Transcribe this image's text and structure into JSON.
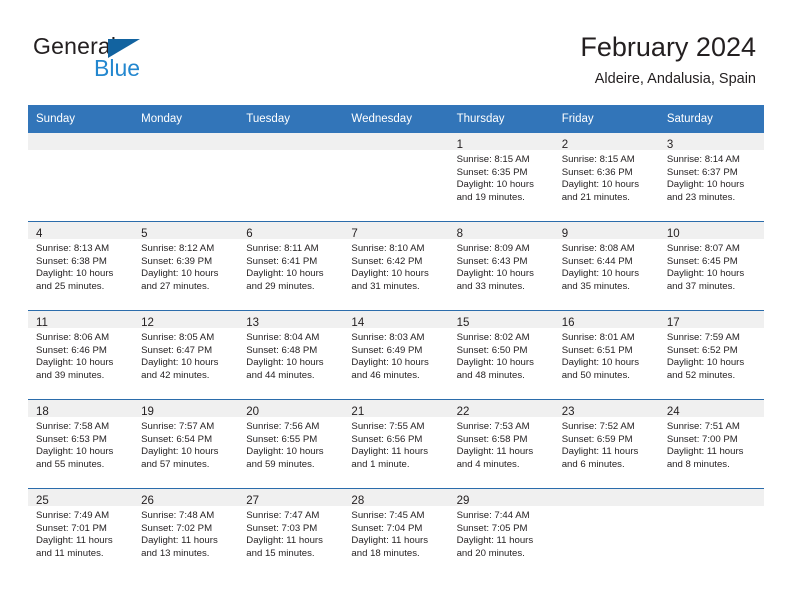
{
  "brand": {
    "name_part1": "General",
    "name_part2": "Blue",
    "triangle_color": "#1263a0",
    "blue_text_color": "#2387cf"
  },
  "header": {
    "title": "February 2024",
    "subtitle": "Aldeire, Andalusia, Spain"
  },
  "theme": {
    "header_row_bg": "#3275b9",
    "row_separator": "#2b6cab",
    "daynum_band_bg": "#f0f0f0",
    "text": "#231f20"
  },
  "weekday_headers": [
    "Sunday",
    "Monday",
    "Tuesday",
    "Wednesday",
    "Thursday",
    "Friday",
    "Saturday"
  ],
  "labels": {
    "sunrise_prefix": "Sunrise:",
    "sunset_prefix": "Sunset:",
    "daylight_prefix": "Daylight:"
  },
  "weeks": [
    [
      {
        "day": "",
        "sunrise": "",
        "sunset": "",
        "daylight_line1": "",
        "daylight_line2": "",
        "empty": true
      },
      {
        "day": "",
        "sunrise": "",
        "sunset": "",
        "daylight_line1": "",
        "daylight_line2": "",
        "empty": true
      },
      {
        "day": "",
        "sunrise": "",
        "sunset": "",
        "daylight_line1": "",
        "daylight_line2": "",
        "empty": true
      },
      {
        "day": "",
        "sunrise": "",
        "sunset": "",
        "daylight_line1": "",
        "daylight_line2": "",
        "empty": true
      },
      {
        "day": "1",
        "sunrise": "Sunrise: 8:15 AM",
        "sunset": "Sunset: 6:35 PM",
        "daylight_line1": "Daylight: 10 hours",
        "daylight_line2": "and 19 minutes."
      },
      {
        "day": "2",
        "sunrise": "Sunrise: 8:15 AM",
        "sunset": "Sunset: 6:36 PM",
        "daylight_line1": "Daylight: 10 hours",
        "daylight_line2": "and 21 minutes."
      },
      {
        "day": "3",
        "sunrise": "Sunrise: 8:14 AM",
        "sunset": "Sunset: 6:37 PM",
        "daylight_line1": "Daylight: 10 hours",
        "daylight_line2": "and 23 minutes."
      }
    ],
    [
      {
        "day": "4",
        "sunrise": "Sunrise: 8:13 AM",
        "sunset": "Sunset: 6:38 PM",
        "daylight_line1": "Daylight: 10 hours",
        "daylight_line2": "and 25 minutes."
      },
      {
        "day": "5",
        "sunrise": "Sunrise: 8:12 AM",
        "sunset": "Sunset: 6:39 PM",
        "daylight_line1": "Daylight: 10 hours",
        "daylight_line2": "and 27 minutes."
      },
      {
        "day": "6",
        "sunrise": "Sunrise: 8:11 AM",
        "sunset": "Sunset: 6:41 PM",
        "daylight_line1": "Daylight: 10 hours",
        "daylight_line2": "and 29 minutes."
      },
      {
        "day": "7",
        "sunrise": "Sunrise: 8:10 AM",
        "sunset": "Sunset: 6:42 PM",
        "daylight_line1": "Daylight: 10 hours",
        "daylight_line2": "and 31 minutes."
      },
      {
        "day": "8",
        "sunrise": "Sunrise: 8:09 AM",
        "sunset": "Sunset: 6:43 PM",
        "daylight_line1": "Daylight: 10 hours",
        "daylight_line2": "and 33 minutes."
      },
      {
        "day": "9",
        "sunrise": "Sunrise: 8:08 AM",
        "sunset": "Sunset: 6:44 PM",
        "daylight_line1": "Daylight: 10 hours",
        "daylight_line2": "and 35 minutes."
      },
      {
        "day": "10",
        "sunrise": "Sunrise: 8:07 AM",
        "sunset": "Sunset: 6:45 PM",
        "daylight_line1": "Daylight: 10 hours",
        "daylight_line2": "and 37 minutes."
      }
    ],
    [
      {
        "day": "11",
        "sunrise": "Sunrise: 8:06 AM",
        "sunset": "Sunset: 6:46 PM",
        "daylight_line1": "Daylight: 10 hours",
        "daylight_line2": "and 39 minutes."
      },
      {
        "day": "12",
        "sunrise": "Sunrise: 8:05 AM",
        "sunset": "Sunset: 6:47 PM",
        "daylight_line1": "Daylight: 10 hours",
        "daylight_line2": "and 42 minutes."
      },
      {
        "day": "13",
        "sunrise": "Sunrise: 8:04 AM",
        "sunset": "Sunset: 6:48 PM",
        "daylight_line1": "Daylight: 10 hours",
        "daylight_line2": "and 44 minutes."
      },
      {
        "day": "14",
        "sunrise": "Sunrise: 8:03 AM",
        "sunset": "Sunset: 6:49 PM",
        "daylight_line1": "Daylight: 10 hours",
        "daylight_line2": "and 46 minutes."
      },
      {
        "day": "15",
        "sunrise": "Sunrise: 8:02 AM",
        "sunset": "Sunset: 6:50 PM",
        "daylight_line1": "Daylight: 10 hours",
        "daylight_line2": "and 48 minutes."
      },
      {
        "day": "16",
        "sunrise": "Sunrise: 8:01 AM",
        "sunset": "Sunset: 6:51 PM",
        "daylight_line1": "Daylight: 10 hours",
        "daylight_line2": "and 50 minutes."
      },
      {
        "day": "17",
        "sunrise": "Sunrise: 7:59 AM",
        "sunset": "Sunset: 6:52 PM",
        "daylight_line1": "Daylight: 10 hours",
        "daylight_line2": "and 52 minutes."
      }
    ],
    [
      {
        "day": "18",
        "sunrise": "Sunrise: 7:58 AM",
        "sunset": "Sunset: 6:53 PM",
        "daylight_line1": "Daylight: 10 hours",
        "daylight_line2": "and 55 minutes."
      },
      {
        "day": "19",
        "sunrise": "Sunrise: 7:57 AM",
        "sunset": "Sunset: 6:54 PM",
        "daylight_line1": "Daylight: 10 hours",
        "daylight_line2": "and 57 minutes."
      },
      {
        "day": "20",
        "sunrise": "Sunrise: 7:56 AM",
        "sunset": "Sunset: 6:55 PM",
        "daylight_line1": "Daylight: 10 hours",
        "daylight_line2": "and 59 minutes."
      },
      {
        "day": "21",
        "sunrise": "Sunrise: 7:55 AM",
        "sunset": "Sunset: 6:56 PM",
        "daylight_line1": "Daylight: 11 hours",
        "daylight_line2": "and 1 minute."
      },
      {
        "day": "22",
        "sunrise": "Sunrise: 7:53 AM",
        "sunset": "Sunset: 6:58 PM",
        "daylight_line1": "Daylight: 11 hours",
        "daylight_line2": "and 4 minutes."
      },
      {
        "day": "23",
        "sunrise": "Sunrise: 7:52 AM",
        "sunset": "Sunset: 6:59 PM",
        "daylight_line1": "Daylight: 11 hours",
        "daylight_line2": "and 6 minutes."
      },
      {
        "day": "24",
        "sunrise": "Sunrise: 7:51 AM",
        "sunset": "Sunset: 7:00 PM",
        "daylight_line1": "Daylight: 11 hours",
        "daylight_line2": "and 8 minutes."
      }
    ],
    [
      {
        "day": "25",
        "sunrise": "Sunrise: 7:49 AM",
        "sunset": "Sunset: 7:01 PM",
        "daylight_line1": "Daylight: 11 hours",
        "daylight_line2": "and 11 minutes."
      },
      {
        "day": "26",
        "sunrise": "Sunrise: 7:48 AM",
        "sunset": "Sunset: 7:02 PM",
        "daylight_line1": "Daylight: 11 hours",
        "daylight_line2": "and 13 minutes."
      },
      {
        "day": "27",
        "sunrise": "Sunrise: 7:47 AM",
        "sunset": "Sunset: 7:03 PM",
        "daylight_line1": "Daylight: 11 hours",
        "daylight_line2": "and 15 minutes."
      },
      {
        "day": "28",
        "sunrise": "Sunrise: 7:45 AM",
        "sunset": "Sunset: 7:04 PM",
        "daylight_line1": "Daylight: 11 hours",
        "daylight_line2": "and 18 minutes."
      },
      {
        "day": "29",
        "sunrise": "Sunrise: 7:44 AM",
        "sunset": "Sunset: 7:05 PM",
        "daylight_line1": "Daylight: 11 hours",
        "daylight_line2": "and 20 minutes."
      },
      {
        "day": "",
        "sunrise": "",
        "sunset": "",
        "daylight_line1": "",
        "daylight_line2": "",
        "empty": true
      },
      {
        "day": "",
        "sunrise": "",
        "sunset": "",
        "daylight_line1": "",
        "daylight_line2": "",
        "empty": true
      }
    ]
  ]
}
